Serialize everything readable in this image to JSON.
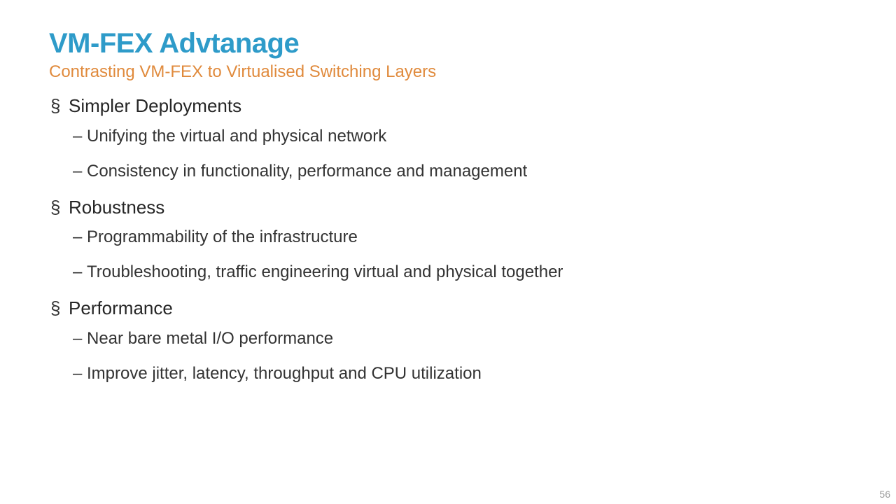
{
  "title": "VM-FEX Advtanage",
  "subtitle": "Contrasting VM-FEX to Virtualised Switching Layers",
  "sections": [
    {
      "heading": "Simpler Deployments",
      "items": [
        "Unifying the virtual and physical network",
        "Consistency in functionality, performance and management"
      ]
    },
    {
      "heading": "Robustness",
      "items": [
        "Programmability of the infrastructure",
        "Troubleshooting, traffic engineering virtual and physical together"
      ]
    },
    {
      "heading": "Performance",
      "items": [
        "Near bare metal I/O performance",
        "Improve jitter, latency, throughput and CPU utilization"
      ]
    }
  ],
  "page_number": "56"
}
